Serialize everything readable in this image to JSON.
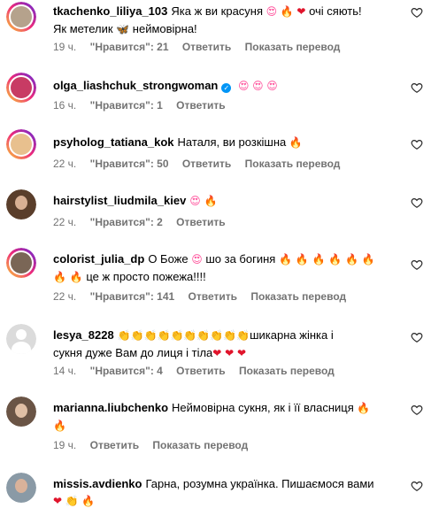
{
  "comments": [
    {
      "username": "tkachenko_liliya_103",
      "text_a": "Яка ж ви красуня",
      "text_b": "очі сяють!",
      "text_c": "Як метелик",
      "text_d": "неймовірна!",
      "time": "19 ч.",
      "likes": "\"Нравится\": 21",
      "reply": "Ответить",
      "translate": "Показать перевод"
    },
    {
      "username": "olga_liashchuk_strongwoman",
      "time": "16 ч.",
      "likes": "\"Нравится\": 1",
      "reply": "Ответить"
    },
    {
      "username": "psyholog_tatiana_kok",
      "text_a": "Наталя, ви розкішна",
      "time": "22 ч.",
      "likes": "\"Нравится\": 50",
      "reply": "Ответить",
      "translate": "Показать перевод"
    },
    {
      "username": "hairstylist_liudmila_kiev",
      "time": "22 ч.",
      "likes": "\"Нравится\": 2",
      "reply": "Ответить"
    },
    {
      "username": "colorist_julia_dp",
      "text_a": "О Боже",
      "text_b": "шо за богиня",
      "text_c": "це ж просто пожежа!!!!",
      "time": "22 ч.",
      "likes": "\"Нравится\": 141",
      "reply": "Ответить",
      "translate": "Показать перевод"
    },
    {
      "username": "lesya_8228",
      "text_a": "шикарна жінка і",
      "text_b": "сукня дуже Вам до лиця і тіла",
      "time": "14 ч.",
      "likes": "\"Нравится\": 4",
      "reply": "Ответить",
      "translate": "Показать перевод"
    },
    {
      "username": "marianna.liubchenko",
      "text_a": "Неймовірна сукня, як і її власниця",
      "time": "19 ч.",
      "reply": "Ответить",
      "translate": "Показать перевод"
    },
    {
      "username": "missis.avdienko",
      "text_a": "Гарна, розумна українка. Пишаємося вами"
    }
  ],
  "icons": {
    "like": "heart-outline-icon",
    "verified": "verified-badge-icon"
  },
  "colors": {
    "meta": "#737373",
    "verified": "#0095f6"
  }
}
